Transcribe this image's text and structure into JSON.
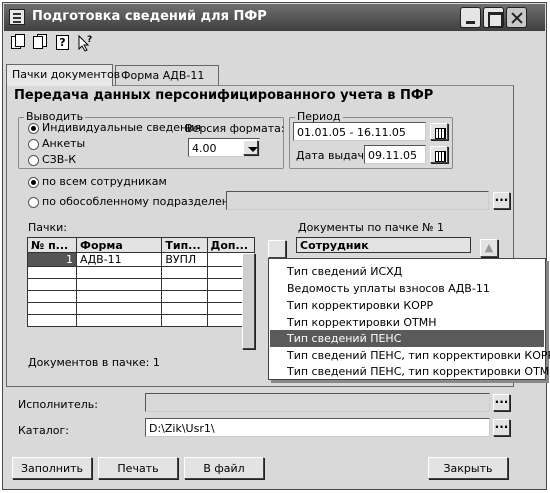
{
  "window": {
    "title": "Подготовка сведений для ПФР"
  },
  "toolbar": {
    "icons": [
      "copy-icon",
      "paste-icon",
      "help-icon",
      "context-help-icon"
    ],
    "help_glyph": "?"
  },
  "tabs": [
    "Пачки документов",
    "Форма АДВ-11"
  ],
  "heading": "Передача данных персонифицированного учета в ПФР",
  "output": {
    "legend": "Выводить",
    "options": [
      "Индивидуальные сведения",
      "Анкеты",
      "СЗВ-К"
    ],
    "selected_index": 0,
    "format_label": "Версия формата:",
    "format_value": "4.00"
  },
  "period": {
    "legend": "Период",
    "range": "01.01.05 - 16.11.05",
    "issue_label": "Дата выдачи:",
    "issue_date": "09.11.05"
  },
  "scope": {
    "all_label": "по всем сотрудникам",
    "branch_label": "по обособленному подразделению:",
    "branch_value": ""
  },
  "packs": {
    "label": "Пачки:",
    "columns": [
      "№ п...",
      "Форма",
      "Тип...",
      "Доп..."
    ],
    "rows": [
      {
        "num": "1",
        "form": "АДВ-11",
        "type": "ВУПЛ",
        "extra": ""
      }
    ],
    "count_label": "Документов в пачке: 1"
  },
  "docs": {
    "label": "Документы по пачке № 1",
    "columns": [
      "Сотрудник"
    ]
  },
  "popup_menu": {
    "items": [
      "Тип сведений ИСХД",
      "Ведомость уплаты взносов АДВ-11",
      "Тип корректировки КОРР",
      "Тип корректировки ОТМН",
      "Тип сведений ПЕНС",
      "Тип сведений ПЕНС, тип корректировки КОРР",
      "Тип сведений ПЕНС, тип корректировки ОТМН"
    ],
    "highlighted_index": 4
  },
  "executor": {
    "label": "Исполнитель:",
    "value": ""
  },
  "catalog": {
    "label": "Каталог:",
    "value": "D:\\Zik\\Usr1\\"
  },
  "buttons": {
    "fill": "Заполнить",
    "print": "Печать",
    "to_file": "В файл",
    "close": "Закрыть"
  },
  "ellipsis": "..."
}
